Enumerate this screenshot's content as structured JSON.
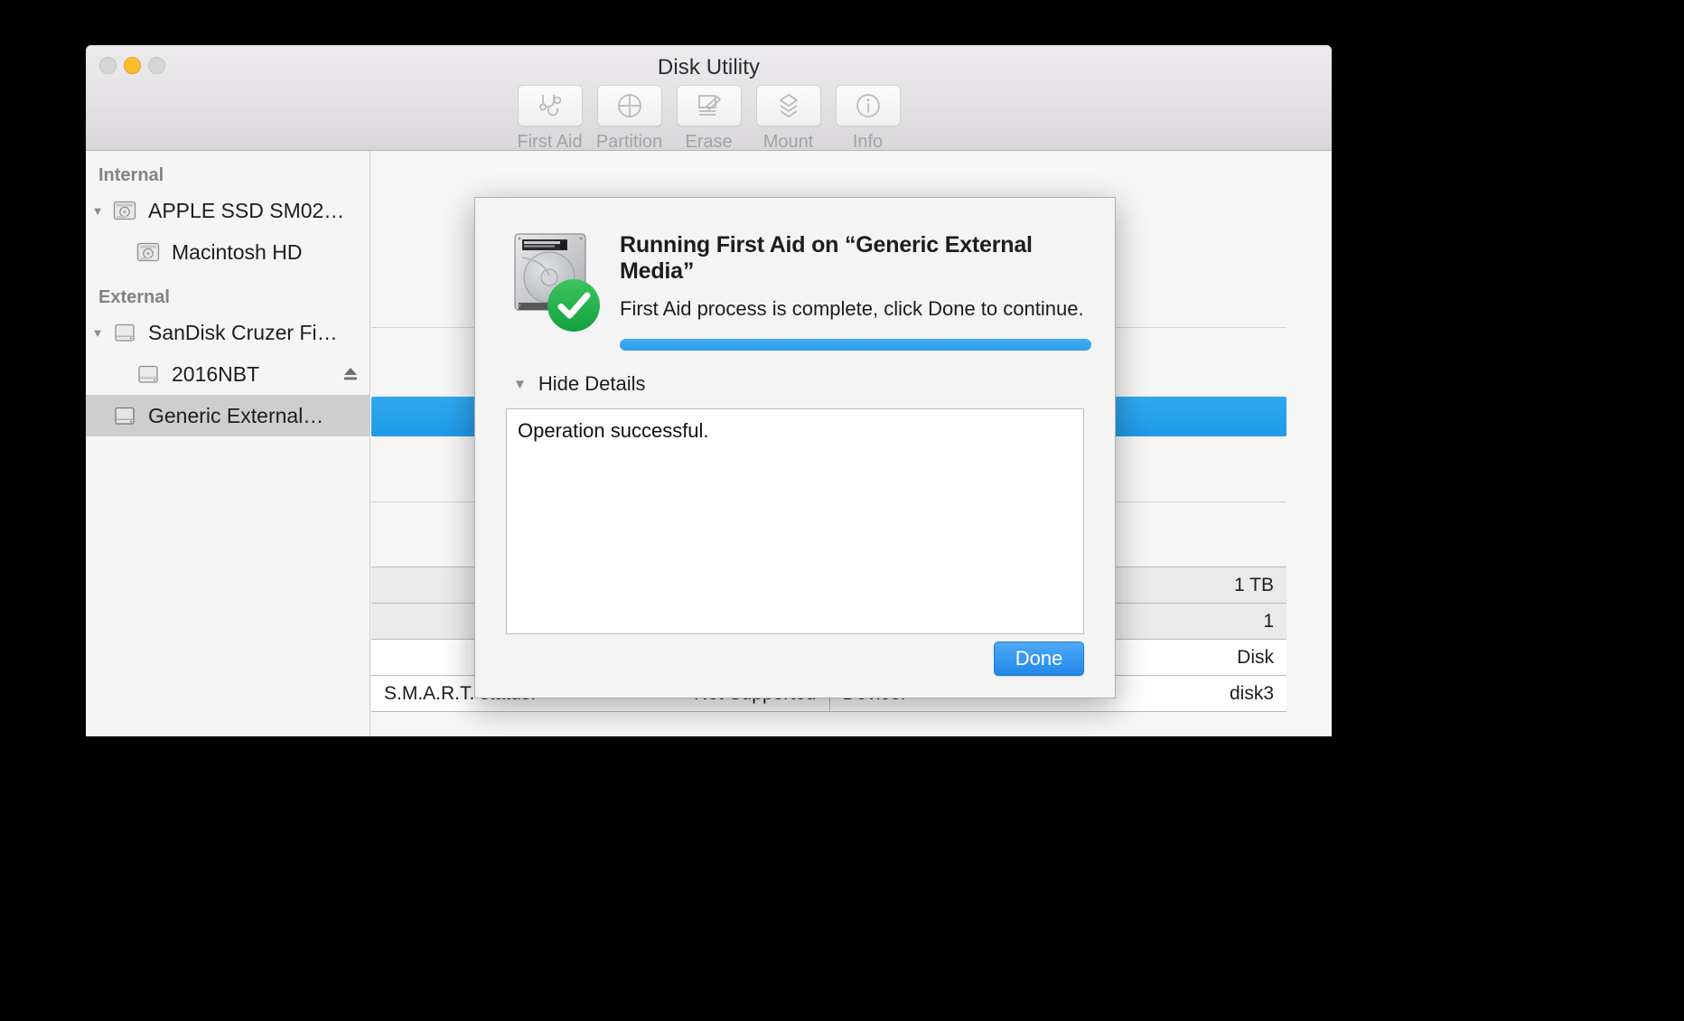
{
  "window": {
    "title": "Disk Utility",
    "traffic_lights": [
      "close-button",
      "minimize-button",
      "zoom-button"
    ]
  },
  "toolbar": {
    "items": [
      {
        "label": "First Aid",
        "icon": "stethoscope-icon"
      },
      {
        "label": "Partition",
        "icon": "pie-chart-icon"
      },
      {
        "label": "Erase",
        "icon": "erase-icon"
      },
      {
        "label": "Mount",
        "icon": "mount-icon"
      },
      {
        "label": "Info",
        "icon": "info-icon"
      }
    ]
  },
  "sidebar": {
    "groups": [
      {
        "header": "Internal",
        "items": [
          {
            "name": "APPLE SSD SM02…",
            "icon": "hard-disk-icon",
            "disclosure": "▼",
            "indent": 0,
            "selected": false,
            "eject": false
          },
          {
            "name": "Macintosh HD",
            "icon": "hard-disk-icon",
            "disclosure": "",
            "indent": 1,
            "selected": false,
            "eject": false
          }
        ]
      },
      {
        "header": "External",
        "items": [
          {
            "name": "SanDisk Cruzer Fi…",
            "icon": "external-drive-icon",
            "disclosure": "▼",
            "indent": 0,
            "selected": false,
            "eject": false
          },
          {
            "name": "2016NBT",
            "icon": "external-drive-icon",
            "disclosure": "",
            "indent": 1,
            "selected": false,
            "eject": true
          },
          {
            "name": "Generic External…",
            "icon": "external-drive-icon",
            "disclosure": "",
            "indent": 0,
            "selected": true,
            "eject": false
          }
        ]
      }
    ]
  },
  "main": {
    "info_rows": [
      {
        "label": "",
        "value": "1 TB",
        "style": "alt"
      },
      {
        "label": "",
        "value": "1",
        "style": "alt"
      },
      {
        "label": "",
        "value": "Disk",
        "style": "plain"
      }
    ],
    "smart_row": {
      "left_label": "S.M.A.R.T. status:",
      "left_value": "Not Supported",
      "right_label": "Device:",
      "right_value": "disk3"
    }
  },
  "sheet": {
    "icon": "hard-disk-icon",
    "badge_icon": "success-check-icon",
    "title": "Running First Aid on “Generic External Media”",
    "subtitle": "First Aid process is complete, click Done to continue.",
    "progress_percent": 100,
    "details_toggle_label": "Hide Details",
    "details_toggle_triangle": "▼",
    "details_text": "Operation successful.",
    "done_label": "Done"
  },
  "colors": {
    "accent_blue": "#2f9ee9",
    "success_green": "#22b14c",
    "selection_gray": "#cecece"
  }
}
